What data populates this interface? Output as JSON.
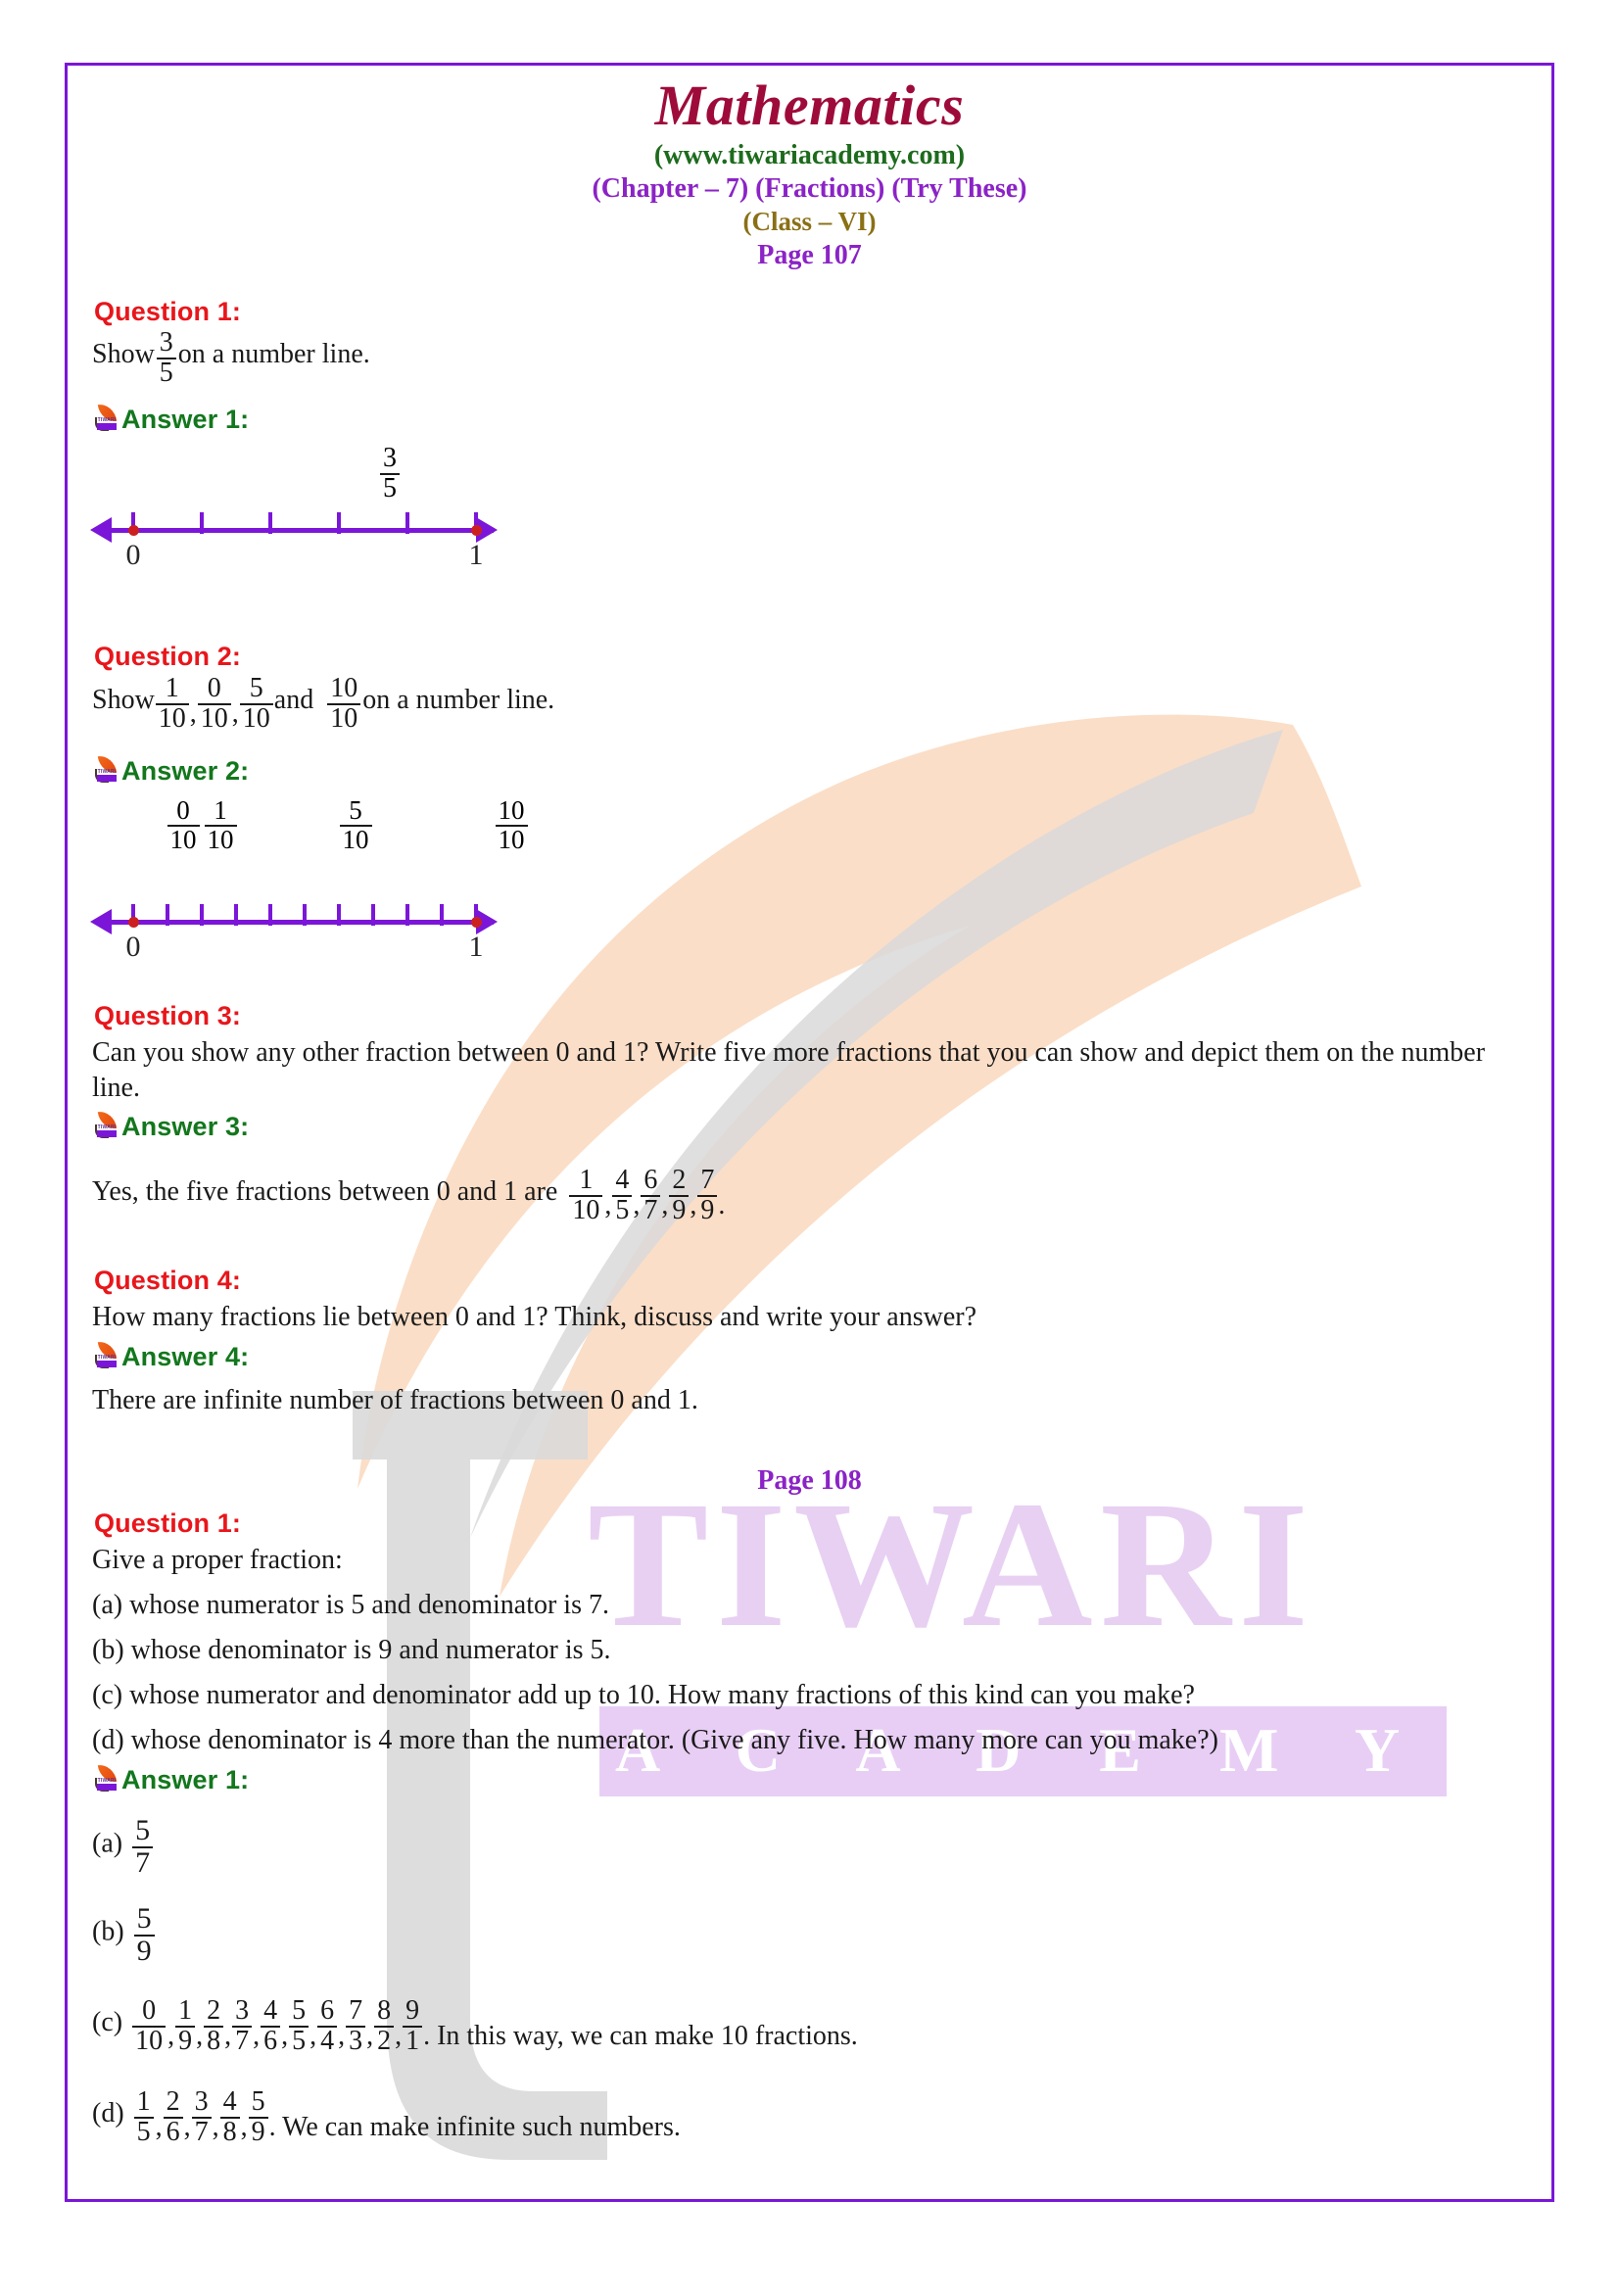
{
  "document": {
    "title": "Mathematics",
    "site_url": "(www.tiwariacademy.com)",
    "chapter_line": "(Chapter – 7) (Fractions) (Try These)",
    "class_line": "(Class – VI)",
    "page_107": "Page 107",
    "page_108": "Page 108",
    "border_color": "#7b16d9",
    "title_color": "#9e0b3a",
    "url_color": "#1d6b1d",
    "chapter_color": "#8b23c6",
    "class_color": "#8a7015"
  },
  "watermark": {
    "word_main": "TIWARI",
    "word_sub": "A C A D E M Y",
    "leaf_color": "#fbdcc4",
    "text_color": "#e8d0f2"
  },
  "icons": {
    "answer_leaf": "leaf-icon"
  },
  "page107": {
    "q1": {
      "label": "Question 1:",
      "text_before": "Show",
      "fraction": {
        "num": "3",
        "den": "5"
      },
      "text_after": "on a number line.",
      "answer_label": "Answer 1:"
    },
    "numberline1": {
      "divisions": 5,
      "start_label": "0",
      "end_label": "1",
      "marked": {
        "num": "3",
        "den": "5",
        "position": 3
      }
    },
    "q2": {
      "label": "Question 2:",
      "text_before": "Show",
      "fractions": [
        {
          "num": "1",
          "den": "10"
        },
        {
          "num": "0",
          "den": "10"
        },
        {
          "num": "5",
          "den": "10"
        }
      ],
      "conjunction": "and",
      "fraction_last": {
        "num": "10",
        "den": "10"
      },
      "text_after": "on a number line.",
      "answer_label": "Answer 2:"
    },
    "numberline2": {
      "divisions": 10,
      "start_label": "0",
      "end_label": "1",
      "marked": [
        {
          "num": "0",
          "den": "10",
          "position": 0
        },
        {
          "num": "1",
          "den": "10",
          "position": 1
        },
        {
          "num": "5",
          "den": "10",
          "position": 5
        },
        {
          "num": "10",
          "den": "10",
          "position": 10
        }
      ]
    },
    "q3": {
      "label": "Question 3:",
      "text": "Can you show any other fraction between 0 and 1? Write five more fractions that you can show and depict them on the number line.",
      "answer_label": "Answer 3:",
      "answer_prefix": "Yes, the five fractions between 0 and 1 are",
      "answer_fractions": [
        {
          "num": "1",
          "den": "10"
        },
        {
          "num": "4",
          "den": "5"
        },
        {
          "num": "6",
          "den": "7"
        },
        {
          "num": "2",
          "den": "9"
        },
        {
          "num": "7",
          "den": "9"
        }
      ],
      "answer_suffix": "."
    },
    "q4": {
      "label": "Question 4:",
      "text": "How many fractions lie between 0 and 1? Think, discuss and write your answer?",
      "answer_label": "Answer 4:",
      "answer_text": "There are infinite number of fractions between 0 and 1."
    }
  },
  "page108": {
    "q1": {
      "label": "Question 1:",
      "intro": "Give a proper fraction:",
      "items": [
        "(a) whose numerator is 5 and denominator is 7.",
        "(b) whose denominator is 9 and numerator is 5.",
        "(c) whose numerator and denominator add up to 10. How many fractions of this kind can you make?",
        "(d) whose denominator is 4 more than the numerator. (Give any five. How many more can you make?)"
      ],
      "answer_label": "Answer 1:",
      "answers": {
        "a": {
          "marker": "(a)",
          "fraction": {
            "num": "5",
            "den": "7"
          }
        },
        "b": {
          "marker": "(b)",
          "fraction": {
            "num": "5",
            "den": "9"
          }
        },
        "c": {
          "marker": "(c)",
          "fractions": [
            {
              "num": "0",
              "den": "10"
            },
            {
              "num": "1",
              "den": "9"
            },
            {
              "num": "2",
              "den": "8"
            },
            {
              "num": "3",
              "den": "7"
            },
            {
              "num": "4",
              "den": "6"
            },
            {
              "num": "5",
              "den": "5"
            },
            {
              "num": "6",
              "den": "4"
            },
            {
              "num": "7",
              "den": "3"
            },
            {
              "num": "8",
              "den": "2"
            },
            {
              "num": "9",
              "den": "1"
            }
          ],
          "suffix": ".  In this way, we can make 10 fractions."
        },
        "d": {
          "marker": "(d)",
          "fractions": [
            {
              "num": "1",
              "den": "5"
            },
            {
              "num": "2",
              "den": "6"
            },
            {
              "num": "3",
              "den": "7"
            },
            {
              "num": "4",
              "den": "8"
            },
            {
              "num": "5",
              "den": "9"
            }
          ],
          "suffix": ". We can make infinite such numbers."
        }
      }
    }
  }
}
